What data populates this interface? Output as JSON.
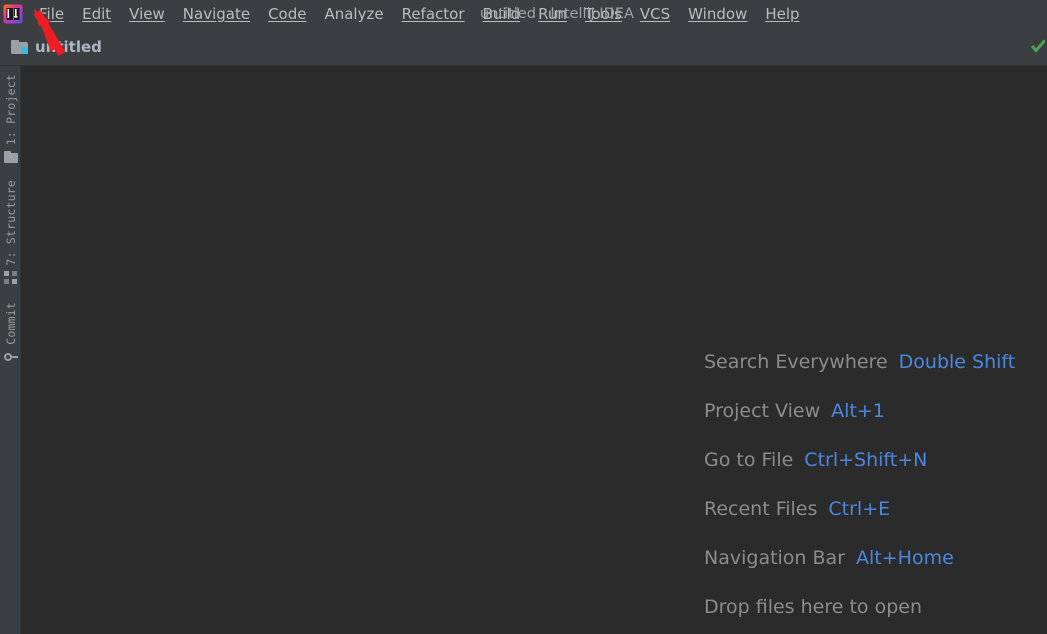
{
  "window": {
    "title": "untitled - IntelliJ IDEA",
    "app_logo_icon": "intellij-idea-logo-icon"
  },
  "menubar": {
    "items": [
      {
        "label": "File",
        "mnemonic_index": 0
      },
      {
        "label": "Edit",
        "mnemonic_index": 0
      },
      {
        "label": "View",
        "mnemonic_index": 0
      },
      {
        "label": "Navigate",
        "mnemonic_index": 0
      },
      {
        "label": "Code",
        "mnemonic_index": 0
      },
      {
        "label": "Analyze",
        "mnemonic_index": 5
      },
      {
        "label": "Refactor",
        "mnemonic_index": 0
      },
      {
        "label": "Build",
        "mnemonic_index": 0
      },
      {
        "label": "Run",
        "mnemonic_index": 1
      },
      {
        "label": "Tools",
        "mnemonic_index": 0
      },
      {
        "label": "VCS",
        "mnemonic_index": 2
      },
      {
        "label": "Window",
        "mnemonic_index": 0
      },
      {
        "label": "Help",
        "mnemonic_index": 0
      }
    ]
  },
  "navbar": {
    "project_name": "untitled",
    "folder_icon": "project-folder-icon",
    "inspection_icon": "inspections-ok-checkmark-icon"
  },
  "toolstrip": {
    "tabs": [
      {
        "label": "1: Project",
        "icon": "folder-icon",
        "name": "project"
      },
      {
        "label": "7: Structure",
        "icon": "structure-icon",
        "name": "structure"
      },
      {
        "label": "Commit",
        "icon": "commit-icon",
        "name": "commit"
      }
    ]
  },
  "editor": {
    "tips": [
      {
        "label": "Search Everywhere",
        "shortcut": "Double Shift"
      },
      {
        "label": "Project View",
        "shortcut": "Alt+1"
      },
      {
        "label": "Go to File",
        "shortcut": "Ctrl+Shift+N"
      },
      {
        "label": "Recent Files",
        "shortcut": "Ctrl+E"
      },
      {
        "label": "Navigation Bar",
        "shortcut": "Alt+Home"
      },
      {
        "label": "Drop files here to open",
        "shortcut": ""
      }
    ]
  },
  "annotation": {
    "arrow_icon": "red-arrow-pointer-icon",
    "target": "File",
    "color": "#ee1c23"
  },
  "colors": {
    "menubar_bg": "#3c3f41",
    "editor_bg": "#2b2b2b",
    "tip_label": "#8c8c8c",
    "tip_shortcut": "#4a88e0",
    "accent_blue": "#40b6e0",
    "inspection_green": "#49a350"
  }
}
